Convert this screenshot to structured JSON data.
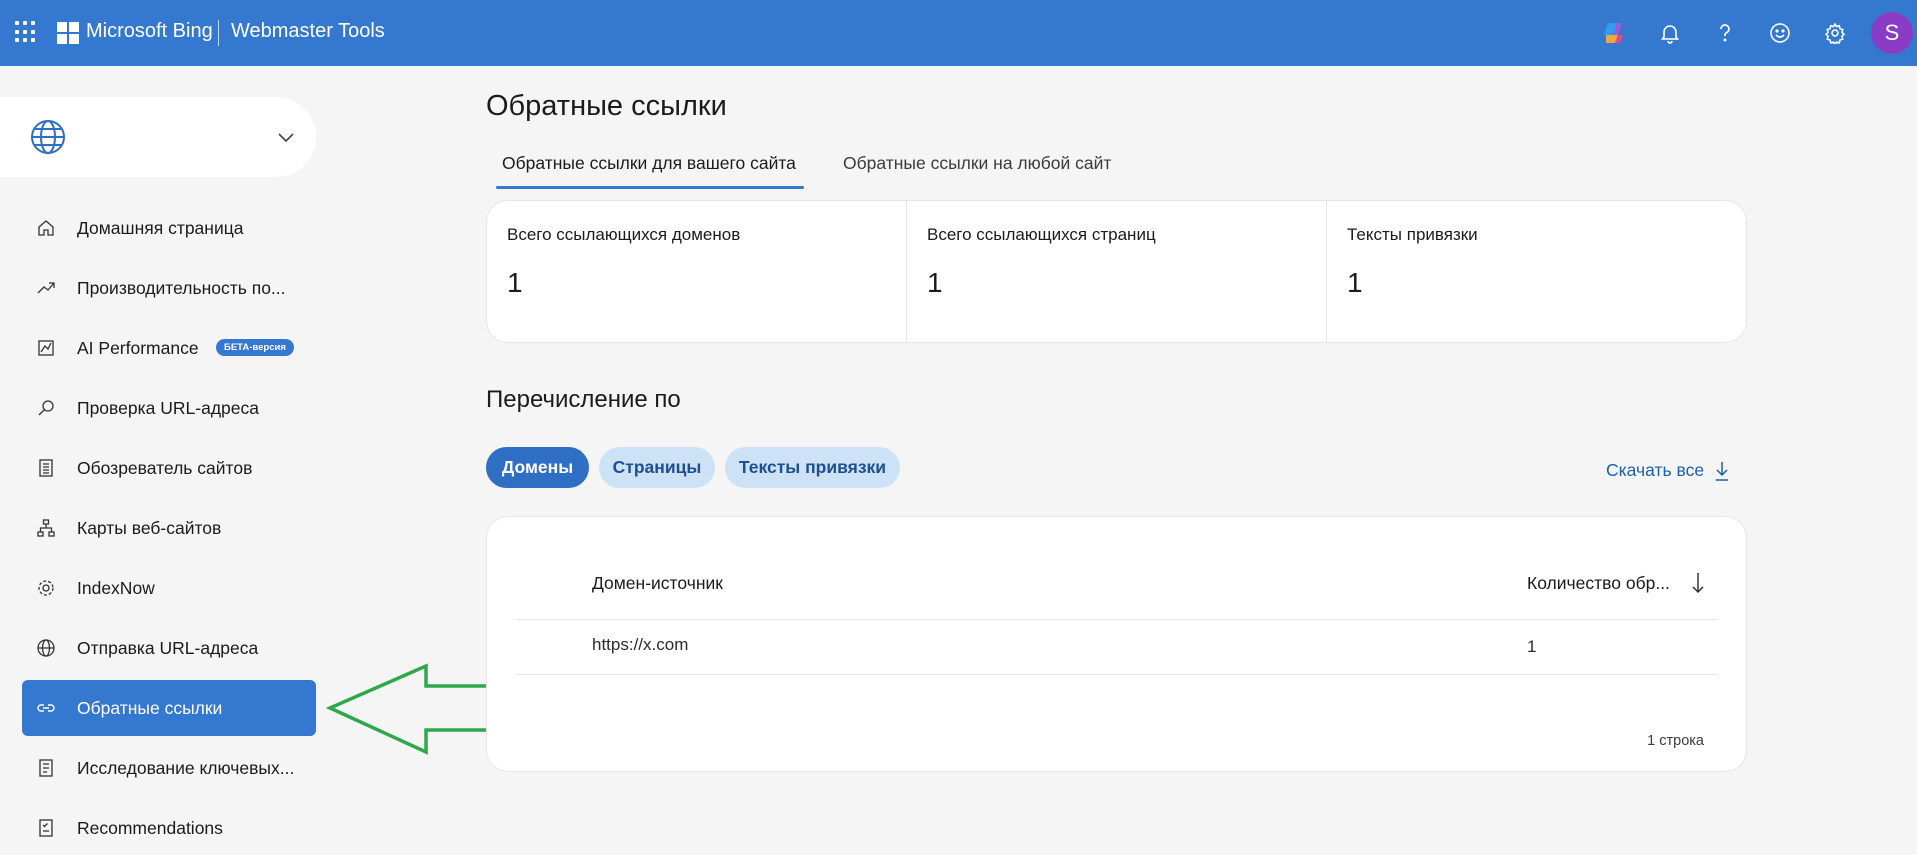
{
  "header": {
    "brand": "Microsoft Bing",
    "product": "Webmaster Tools",
    "avatar_initial": "S",
    "icons": [
      "app-launcher-icon",
      "copilot-icon",
      "bell-icon",
      "help-icon",
      "feedback-smiley-icon",
      "settings-gear-icon"
    ],
    "bar_color": "#3478d0"
  },
  "sidebar": {
    "site_selector_icon": "globe-icon",
    "items": [
      {
        "label": "Домашняя страница",
        "icon": "home-icon"
      },
      {
        "label": "Производительность по...",
        "icon": "trend-icon"
      },
      {
        "label": "AI Performance",
        "icon": "chart-icon",
        "badge": "БЕТА-версия"
      },
      {
        "label": "Проверка URL-адреса",
        "icon": "search-icon"
      },
      {
        "label": "Обозреватель сайтов",
        "icon": "list-icon"
      },
      {
        "label": "Карты веб-сайтов",
        "icon": "sitemap-icon"
      },
      {
        "label": "IndexNow",
        "icon": "gear-icon"
      },
      {
        "label": "Отправка URL-адреса",
        "icon": "globe-icon"
      },
      {
        "label": "Обратные ссылки",
        "icon": "link-icon",
        "active": true
      },
      {
        "label": "Исследование ключевых...",
        "icon": "document-icon"
      },
      {
        "label": "Recommendations",
        "icon": "checklist-icon"
      }
    ]
  },
  "main": {
    "title": "Обратные ссылки",
    "tabs": [
      {
        "label": "Обратные ссылки для вашего сайта",
        "selected": true
      },
      {
        "label": "Обратные ссылки на любой сайт",
        "selected": false
      }
    ],
    "stats": [
      {
        "label": "Всего ссылающихся доменов",
        "value": "1"
      },
      {
        "label": "Всего ссылающихся страниц",
        "value": "1"
      },
      {
        "label": "Тексты привязки",
        "value": "1"
      }
    ],
    "section_title": "Перечисление по",
    "filters": [
      {
        "label": "Домены",
        "selected": true
      },
      {
        "label": "Страницы",
        "selected": false
      },
      {
        "label": "Тексты привязки",
        "selected": false
      }
    ],
    "download_label": "Скачать все",
    "table": {
      "columns": [
        "Домен-источник",
        "Количество обр..."
      ],
      "rows": [
        {
          "domain": "https://x.com",
          "count": "1"
        }
      ],
      "footer": "1 строка"
    }
  },
  "annotation": {
    "arrow_color": "#2ea84a",
    "points_to": "Обратные ссылки"
  }
}
